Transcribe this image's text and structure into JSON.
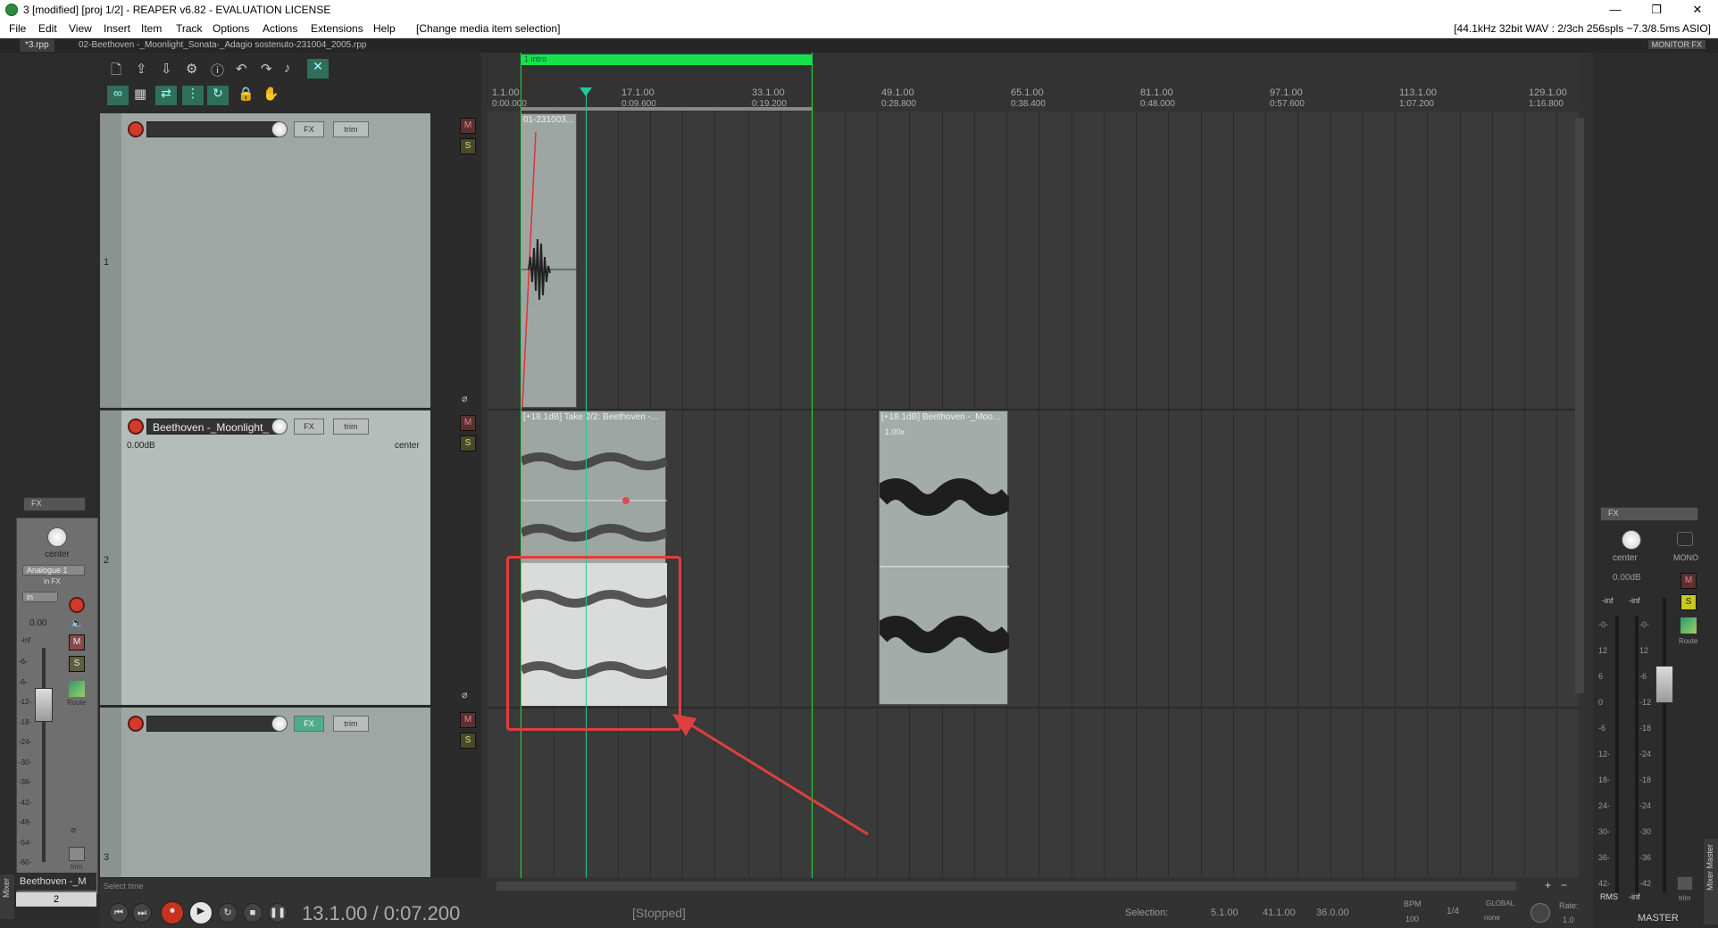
{
  "window": {
    "title": "3 [modified] [proj 1/2] - REAPER v6.82 - EVALUATION LICENSE",
    "minimize": "—",
    "restore": "❐",
    "close": "✕"
  },
  "menu": {
    "items": [
      "File",
      "Edit",
      "View",
      "Insert",
      "Item",
      "Track",
      "Options",
      "Actions",
      "Extensions",
      "Help"
    ],
    "action": "[Change media item selection]",
    "status": "[44.1kHz 32bit WAV : 2/3ch 256spls ~7.3/8.5ms ASIO]"
  },
  "tabs": {
    "active": "*3.rpp",
    "second": "02-Beethoven -_Moonlight_Sonata-_Adagio sostenuto-231004_2005.rpp",
    "monitor_fx": "MONITOR FX"
  },
  "region": {
    "label": "1 intro",
    "color": "#16e24a"
  },
  "ruler": {
    "bars": [
      "1.1.00",
      "17.1.00",
      "33.1.00",
      "49.1.00",
      "65.1.00",
      "81.1.00",
      "97.1.00",
      "113.1.00",
      "129.1.00"
    ],
    "times": [
      "0:00.000",
      "0:09.600",
      "0:19.200",
      "0:28.800",
      "0:38.400",
      "0:48.000",
      "0:57.600",
      "1:07.200",
      "1:16.800"
    ]
  },
  "tracks": [
    {
      "number": "1",
      "name": "",
      "fx": "FX",
      "trim": "trim",
      "mute": "M",
      "solo": "S"
    },
    {
      "number": "2",
      "name": "Beethoven -_Moonlight_",
      "volume": "0.00dB",
      "pan": "center",
      "fx": "FX",
      "trim": "trim",
      "mute": "M",
      "solo": "S"
    },
    {
      "number": "3",
      "name": "",
      "fx": "FX",
      "trim": "trim",
      "mute": "M",
      "solo": "S"
    }
  ],
  "items": [
    {
      "label": "01-231003..."
    },
    {
      "label": "[+18.1dB] Take 2/2: Beethoven -..."
    },
    {
      "label": "[+18.1dB] Beethoven -_Moo...",
      "rate": "1.00x"
    }
  ],
  "left_mixer": {
    "fx": "FX",
    "pan": "center",
    "input": "Analogue 1",
    "in_fx": "in FX",
    "monitor": "in",
    "volume": "0.00",
    "meter_top": "-inf",
    "scale": [
      "-6-",
      "-6-",
      "-12-",
      "-18-",
      "-24-",
      "-30-",
      "-36-",
      "-42-",
      "-48-",
      "-54-",
      "-60-"
    ],
    "route": "Route",
    "trim": "trim",
    "name": "Beethoven -_M",
    "number": "2",
    "mute": "M",
    "solo": "S",
    "dock_label": "Mixer"
  },
  "master": {
    "fx": "FX",
    "pan": "center",
    "mono": "MONO",
    "volume": "0.00dB",
    "peak_l": "-inf",
    "peak_r": "-inf",
    "scale_l": [
      "-0-",
      "12",
      "6",
      "0",
      "-6",
      "12-",
      "18-",
      "24-",
      "30-",
      "36-",
      "42-"
    ],
    "scale_r": [
      "-0-",
      "12",
      "-6",
      "-12",
      "-18",
      "-24",
      "-18",
      "-24",
      "-30",
      "-36",
      "-42"
    ],
    "route": "Route",
    "rms": "RMS",
    "rms_value": "-inf",
    "trim": "trim",
    "label": "MASTER",
    "dock_label": "Mixer Master",
    "mute": "M",
    "solo": "S"
  },
  "transport": {
    "hint": "Select time",
    "position": "13.1.00 / 0:07.200",
    "state": "[Stopped]",
    "selection_label": "Selection:",
    "sel_start": "5.1.00",
    "sel_end": "41.1.00",
    "sel_length": "36.0.00",
    "bpm_label": "BPM",
    "bpm_value": "100",
    "timesig": "1/4",
    "global_label": "GLOBAL",
    "global_value": "none",
    "rate_label": "Rate:",
    "rate_value": "1.0"
  },
  "colors": {
    "region": "#16e24a",
    "cursor": "#1fc99a",
    "annotation": "#e03e3e",
    "arrange_bg": "#3a3a3a",
    "track_bg": "#9fa7a5"
  }
}
